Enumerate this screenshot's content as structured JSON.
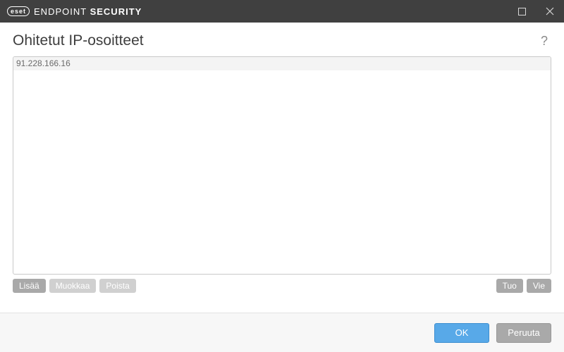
{
  "titlebar": {
    "brand_badge": "eset",
    "brand_light": "ENDPOINT ",
    "brand_bold": "SECURITY"
  },
  "header": {
    "title": "Ohitetut IP-osoitteet",
    "help_symbol": "?"
  },
  "list": {
    "items": [
      "91.228.166.16"
    ]
  },
  "buttons": {
    "add": "Lisää",
    "edit": "Muokkaa",
    "delete": "Poista",
    "import": "Tuo",
    "export": "Vie"
  },
  "footer": {
    "ok": "OK",
    "cancel": "Peruuta"
  }
}
